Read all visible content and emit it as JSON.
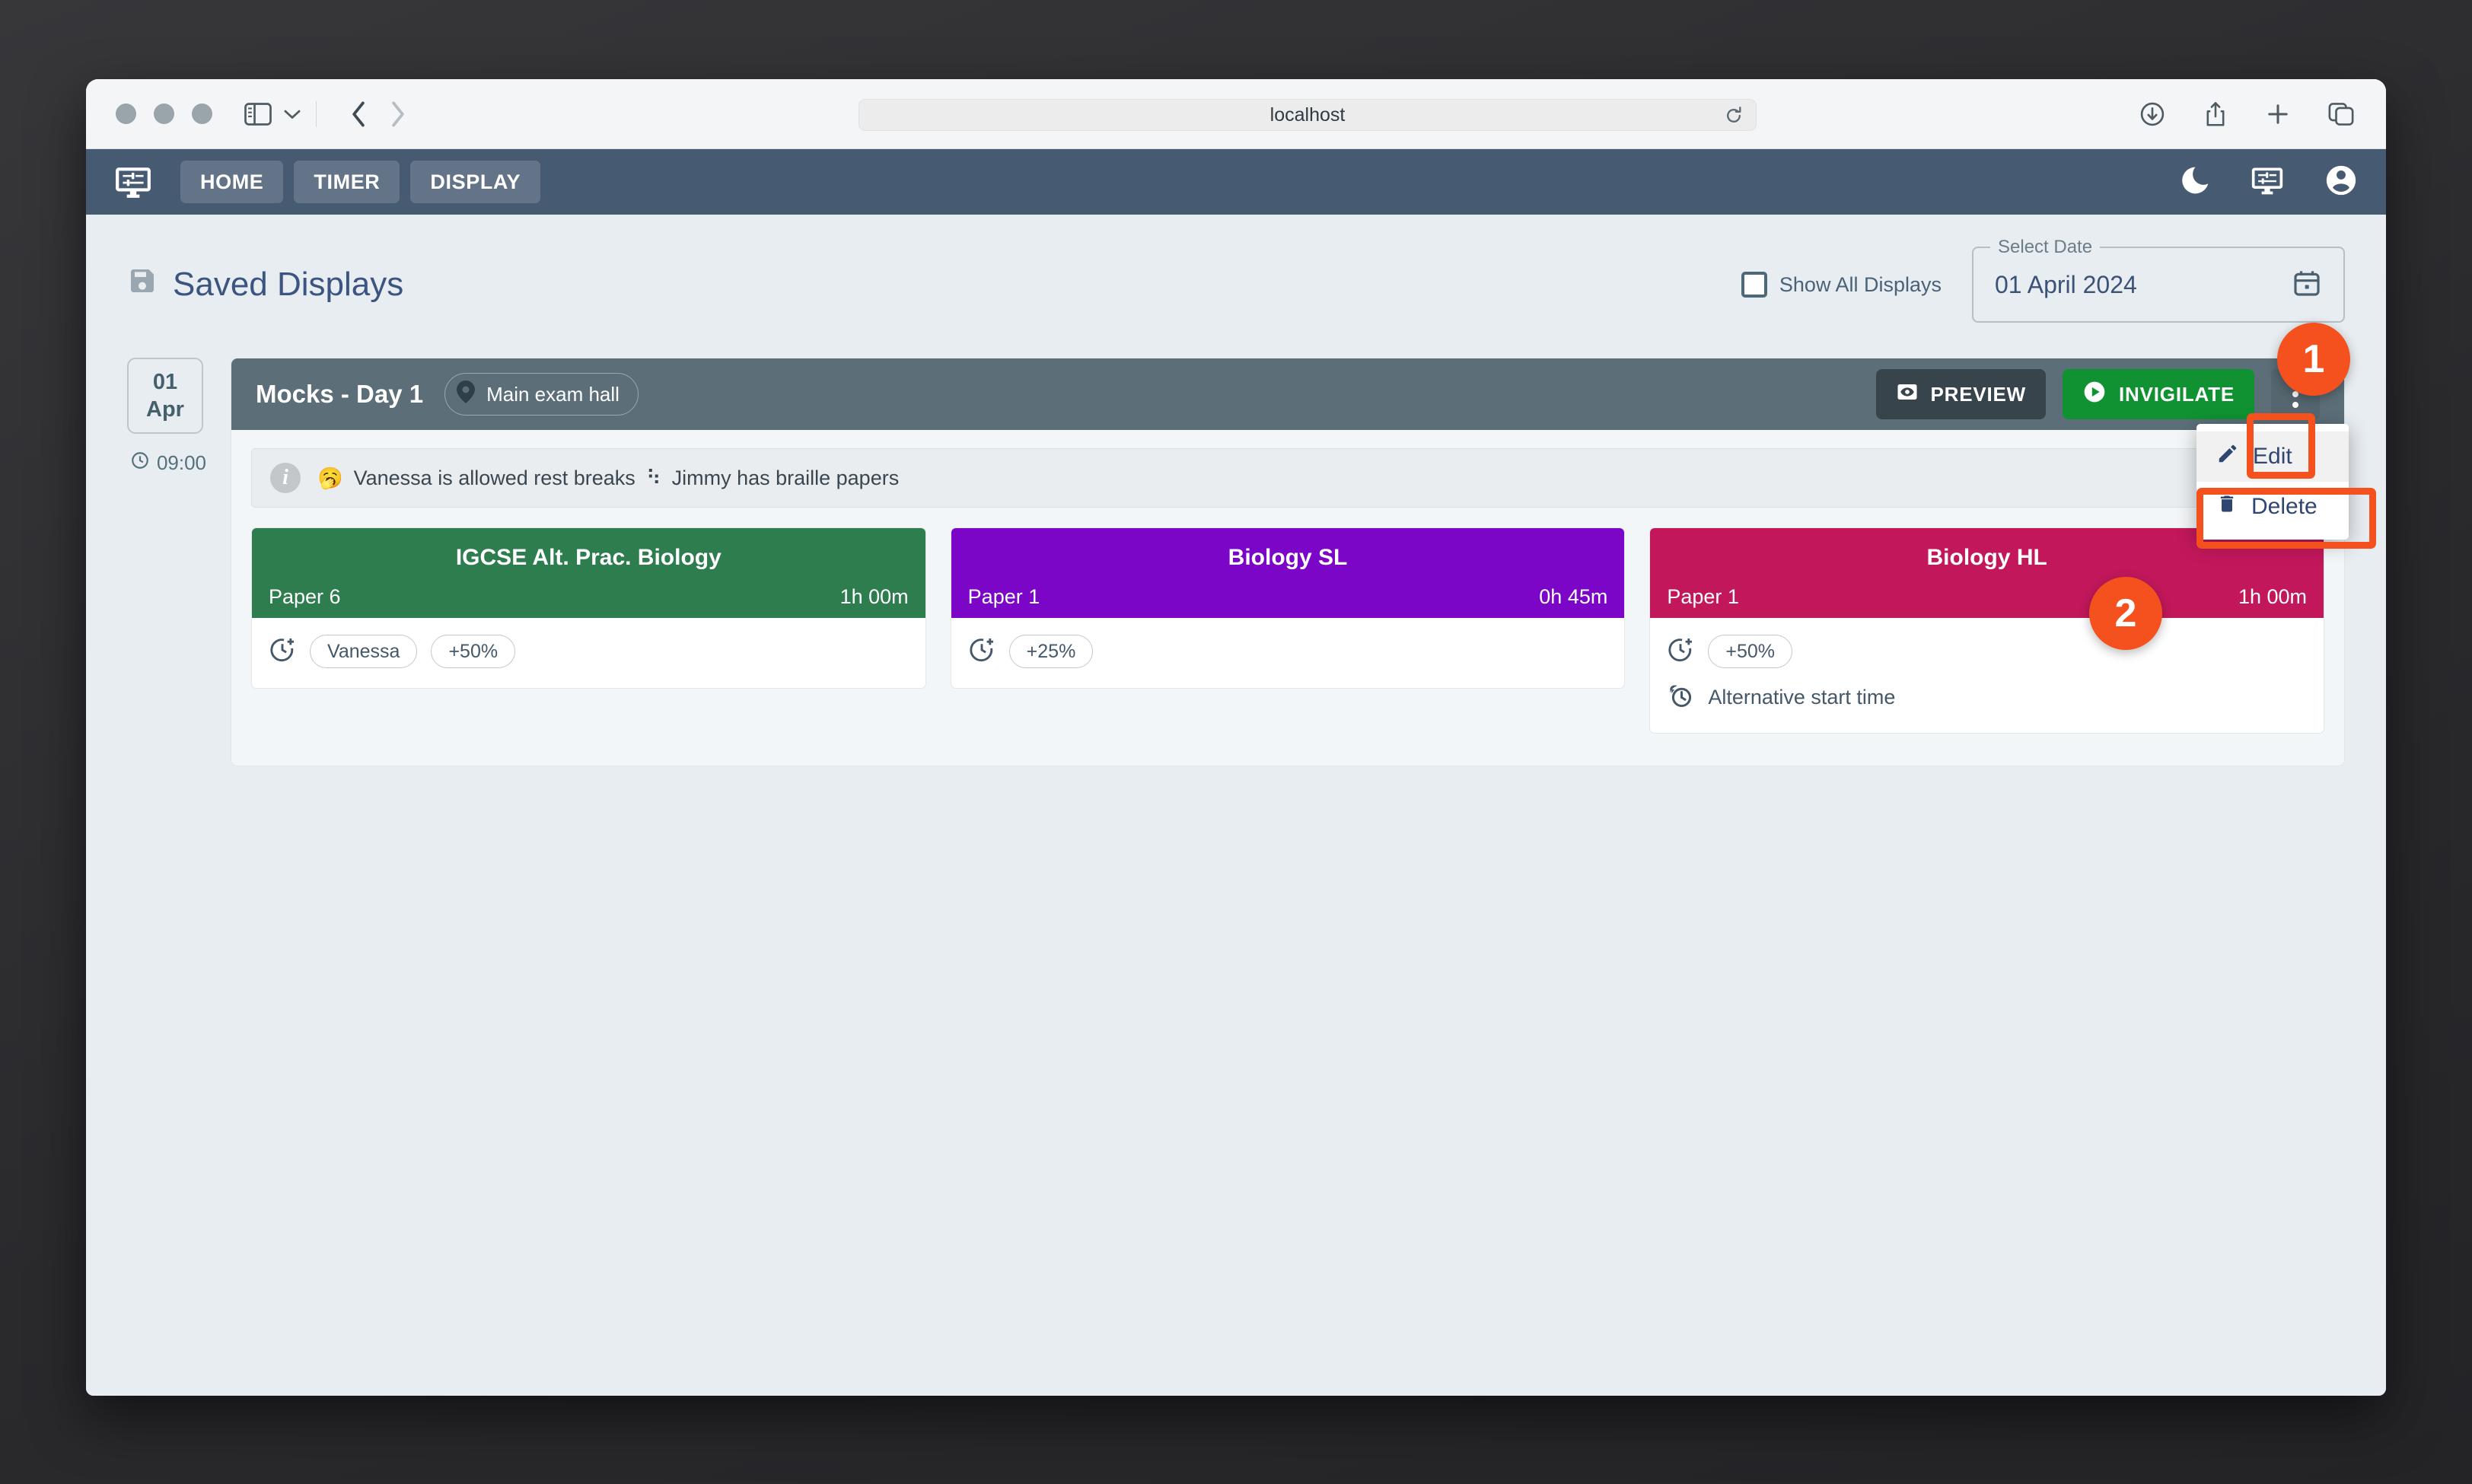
{
  "browser": {
    "url": "localhost",
    "icons": {
      "sidebar": "sidebar-icon",
      "chevron_down": "chevron-down-icon",
      "back": "back-arrow-icon",
      "forward": "forward-arrow-icon",
      "reload": "reload-icon",
      "download": "download-icon",
      "share": "share-icon",
      "new_tab": "plus-icon",
      "tab_overview": "tabs-icon"
    }
  },
  "appbar": {
    "brand_icon": "display-settings-icon",
    "tabs": [
      {
        "label": "HOME",
        "active": true
      },
      {
        "label": "TIMER",
        "active": true
      },
      {
        "label": "DISPLAY",
        "active": true
      }
    ],
    "right_icons": [
      {
        "name": "dark-mode-moon-icon"
      },
      {
        "name": "display-settings-icon"
      },
      {
        "name": "account-circle-icon"
      }
    ],
    "bg": "#465a72"
  },
  "header": {
    "title": "Saved Displays",
    "title_icon": "save-floppy-icon",
    "show_all_label": "Show All Displays",
    "show_all_checked": false,
    "date_legend": "Select Date",
    "date_value": "01 April 2024",
    "calendar_icon": "calendar-icon"
  },
  "day": {
    "day_number": "01",
    "month": "Apr",
    "time": "09:00",
    "clock_icon": "clock-icon"
  },
  "schedule": {
    "title": "Mocks - Day 1",
    "venue": "Main exam hall",
    "venue_icon": "location-pin-icon",
    "preview_label": "PREVIEW",
    "preview_icon": "preview-eye-icon",
    "invigilate_label": "INVIGILATE",
    "invigilate_icon": "play-circle-icon",
    "menu_icon": "more-vertical-icon",
    "header_bg": "#5c6e78",
    "invigilate_bg": "#109232",
    "preview_bg": "#37444c"
  },
  "menu": {
    "items": [
      {
        "label": "Edit",
        "icon": "pencil-edit-icon",
        "hover": true
      },
      {
        "label": "Delete",
        "icon": "trash-delete-icon",
        "hover": false
      }
    ]
  },
  "note": {
    "info_icon": "info-circle-icon",
    "segments": [
      {
        "glyph": "🥱",
        "text": "Vanessa is allowed rest breaks"
      },
      {
        "glyph": "⠳",
        "text": "Jimmy has braille papers"
      }
    ],
    "full_text": "🥱 Vanessa is allowed rest breaks ⠳ Jimmy has braille papers"
  },
  "exams": [
    {
      "name": "IGCSE Alt. Prac. Biology",
      "paper": "Paper 6",
      "duration": "1h 00m",
      "color": "#2e7d4f",
      "accommodations": [
        {
          "icon": "more-time-icon",
          "chips": [
            "Vanessa",
            "+50%"
          ],
          "label": ""
        }
      ]
    },
    {
      "name": "Biology SL",
      "paper": "Paper 1",
      "duration": "0h 45m",
      "color": "#7b06c7",
      "accommodations": [
        {
          "icon": "more-time-icon",
          "chips": [
            "+25%"
          ],
          "label": ""
        }
      ]
    },
    {
      "name": "Biology HL",
      "paper": "Paper 1",
      "duration": "1h 00m",
      "color": "#c2185b",
      "accommodations": [
        {
          "icon": "more-time-icon",
          "chips": [
            "+50%"
          ],
          "label": ""
        },
        {
          "icon": "alarm-clock-icon",
          "chips": [],
          "label": "Alternative start time"
        }
      ]
    }
  ],
  "annotations": {
    "accent": "#f4511e",
    "steps": [
      {
        "number": "1"
      },
      {
        "number": "2"
      }
    ]
  }
}
